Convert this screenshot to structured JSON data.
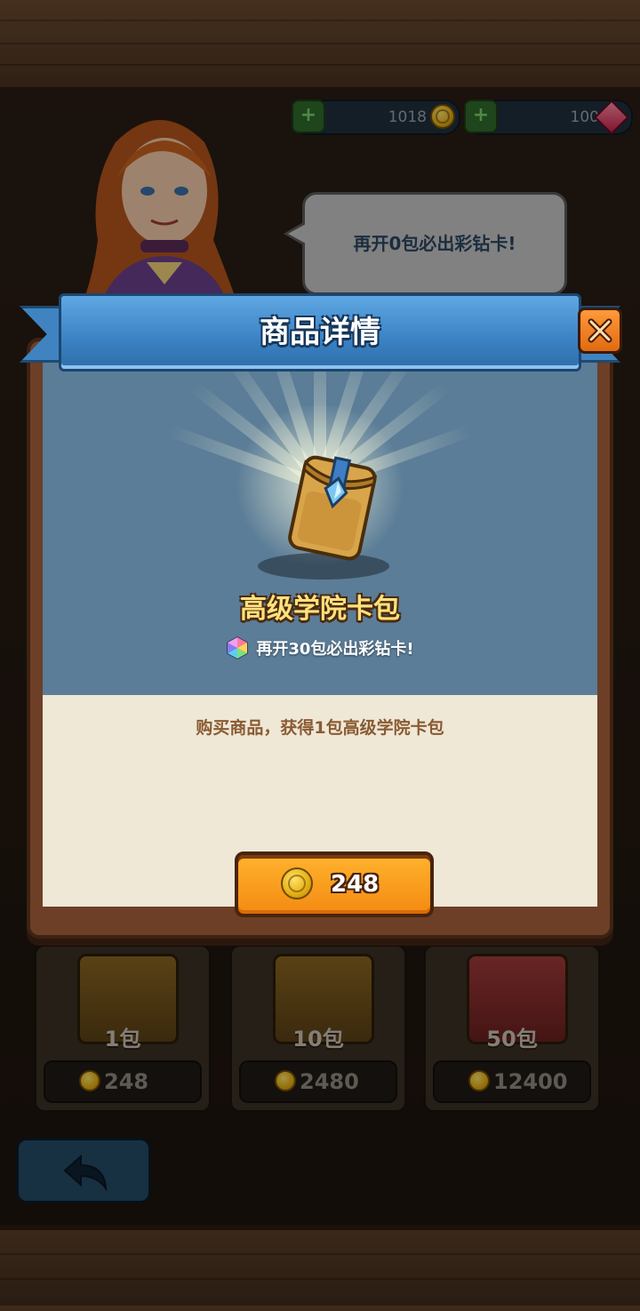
{
  "currency_bar": {
    "coins": "1018",
    "gems": "100"
  },
  "speech_bubble": {
    "text": "再开0包必出彩钻卡!"
  },
  "shop_packs": [
    {
      "label": "1包",
      "price": "248"
    },
    {
      "label": "10包",
      "price": "2480"
    },
    {
      "label": "50包",
      "price": "12400"
    }
  ],
  "dialog": {
    "title": "商品详情",
    "product_name": "高级学院卡包",
    "guarantee_text": "再开30包必出彩钻卡!",
    "description": "购买商品，获得1包高级学院卡包",
    "buy_price": "248"
  },
  "icons": {
    "close": "close-icon",
    "back": "back-arrow-icon",
    "coin": "coin-icon",
    "gem": "gem-icon",
    "rainbow_gem": "rainbow-gem-icon",
    "card_pack": "card-pack-icon"
  },
  "colors": {
    "ribbon_blue": "#3b82c4",
    "buy_orange": "#f48a12",
    "title_gold": "#ffe27a",
    "panel_blue": "#5b7d97",
    "panel_cream": "#efe8d7"
  }
}
